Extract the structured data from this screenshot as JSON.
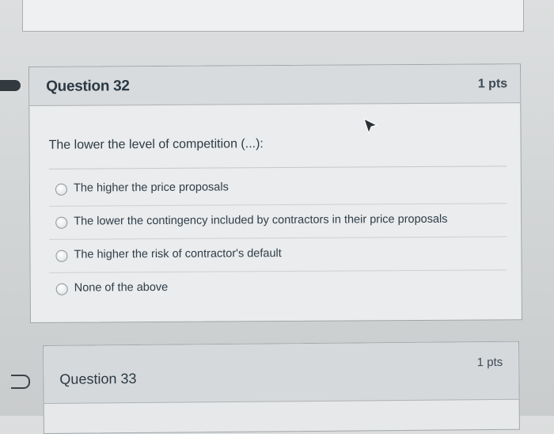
{
  "question_32": {
    "title": "Question 32",
    "points": "1 pts",
    "prompt": "The lower the level of competition (...):",
    "answers": [
      {
        "label": "The higher the price proposals",
        "selected": false
      },
      {
        "label": "The lower the contingency included by contractors in their price proposals",
        "selected": false
      },
      {
        "label": "The higher the risk of contractor's default",
        "selected": false
      },
      {
        "label": "None of the above",
        "selected": false
      }
    ]
  },
  "question_33": {
    "title": "Question 33",
    "points": "1 pts"
  },
  "icons": {
    "flag_marked": "flag-icon-filled",
    "flag_unmarked": "flag-icon-outline",
    "cursor": "mouse-pointer-icon"
  }
}
